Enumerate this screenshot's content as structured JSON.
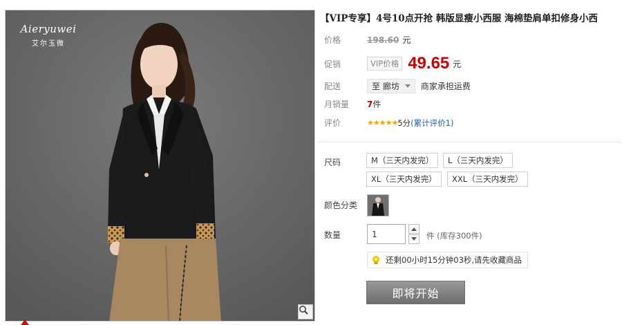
{
  "product": {
    "title": "【VIP专享】4号10点开抢 韩版显瘦小西服 海棉垫肩单扣修身小西",
    "brand_script": "Aieryuwei",
    "brand_cn": "艾尔玉微"
  },
  "pricing": {
    "orig_label": "价格",
    "orig_price": "198.60",
    "orig_unit": "元",
    "promo_label": "促销",
    "vip_tag": "VIP价格",
    "promo_price": "49.65",
    "promo_unit": "元"
  },
  "shipping": {
    "label": "配送",
    "destination": "至 廊坊",
    "note": "商家承担运费"
  },
  "sales": {
    "label": "月销量",
    "count": "7",
    "unit": "件"
  },
  "rating": {
    "label": "评价",
    "stars": "★★★★★",
    "score": "5分",
    "link": "(累计评价1)",
    "value": 5,
    "max": 5
  },
  "sku": {
    "size_label": "尺码",
    "sizes": [
      "M（三天内发完）",
      "L（三天内发完）",
      "XL（三天内发完）",
      "XXL（三天内发完）"
    ],
    "color_label": "颜色分类",
    "qty_label": "数量",
    "qty_value": "1",
    "stock_text": "件 (库存300件)",
    "tip_text": "还剩00小时15分钟03秒,请先收藏商品"
  },
  "cta": {
    "label": "即将开始"
  },
  "icons": {
    "zoom": "magnifier-icon",
    "tip": "lightbulb-icon",
    "qty_up": "chevron-up-icon",
    "qty_down": "chevron-down-icon",
    "marker": "red-triangle-icon"
  },
  "colors": {
    "price_red": "#c40000",
    "star": "#f5a300",
    "cta_gray": "#7e7e7e",
    "photo_bg": "#6b6b6c"
  }
}
